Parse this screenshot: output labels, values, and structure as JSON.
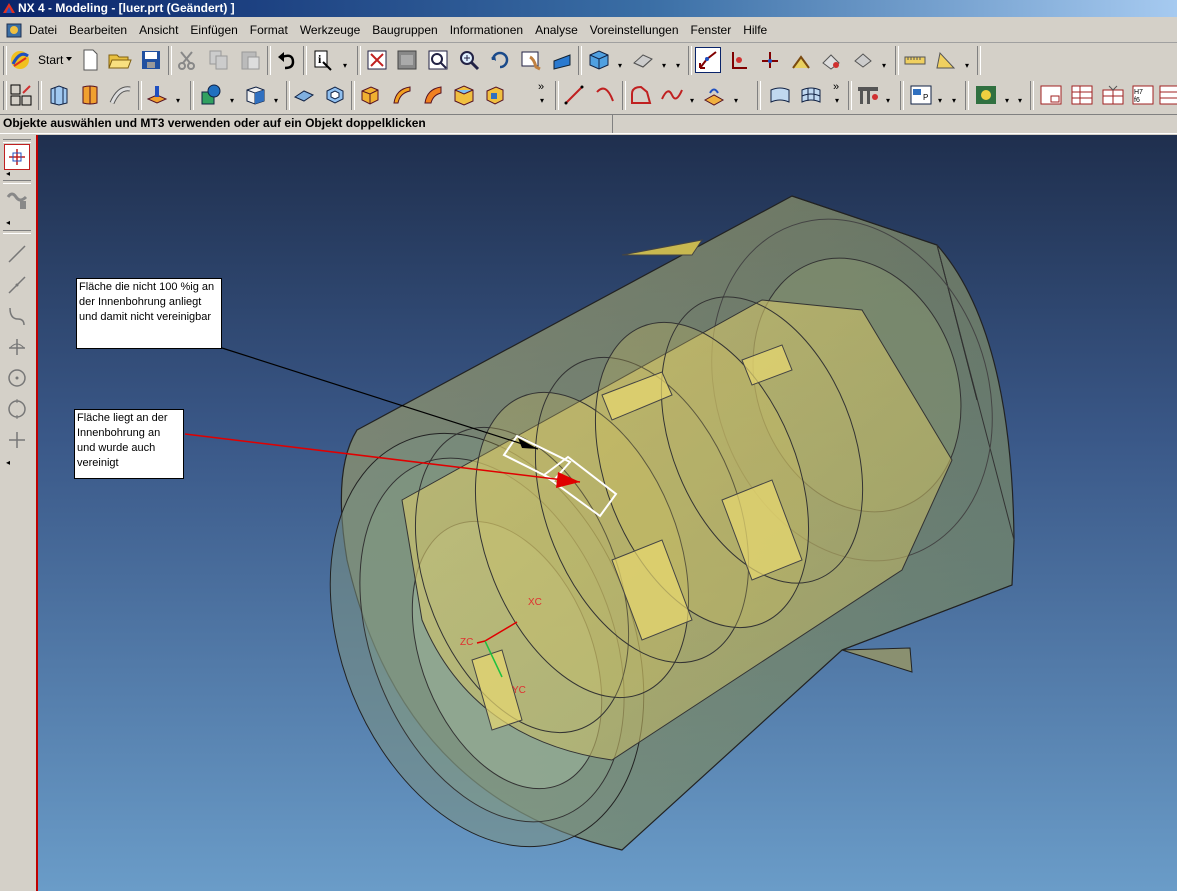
{
  "window": {
    "title": "NX 4 - Modeling - [luer.prt (Geändert) ]"
  },
  "menu": {
    "items": [
      "Datei",
      "Bearbeiten",
      "Ansicht",
      "Einfügen",
      "Format",
      "Werkzeuge",
      "Baugruppen",
      "Informationen",
      "Analyse",
      "Voreinstellungen",
      "Fenster",
      "Hilfe"
    ]
  },
  "toolbar": {
    "start_label": "Start"
  },
  "cue": {
    "text": "Objekte auswählen und MT3 verwenden oder auf ein Objekt doppelklicken"
  },
  "annotations": {
    "note1": "Fläche die nicht 100 %ig an der Innenbohrung anliegt und damit nicht vereinigbar",
    "note2": "Fläche liegt an der Innenbohrung an und wurde auch vereinigt"
  },
  "axes": {
    "zc": "ZC",
    "yc": "YC",
    "xc": "XC"
  },
  "colors": {
    "part_fill": "#c8c070",
    "note1_arrow": "#000000",
    "note2_arrow": "#e00000",
    "viewport_top": "#1f2f4e",
    "viewport_bottom": "#6a9cc8"
  }
}
